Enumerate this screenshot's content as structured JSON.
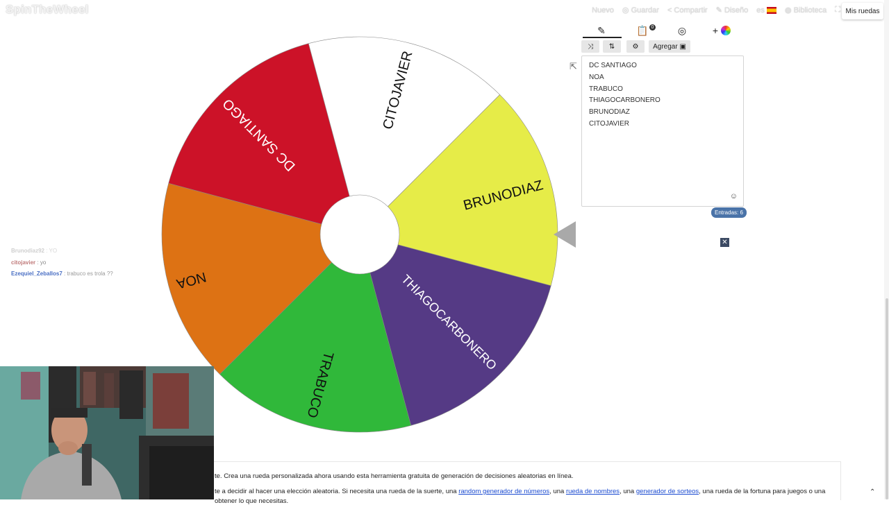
{
  "header": {
    "logo": "SpinTheWheel",
    "nav": [
      "Nuevo",
      "Guardar",
      "Compartir",
      "Diseño",
      "es",
      "Biblioteca"
    ],
    "my_wheels": "Mis ruedas"
  },
  "wheel": {
    "segments": [
      {
        "label": "DC SANTIAGO",
        "color": "#cc1228"
      },
      {
        "label": "NOA",
        "color": "#dd7214"
      },
      {
        "label": "TRABUCO",
        "color": "#30b83a"
      },
      {
        "label": "THIAGOCARBONERO",
        "color": "#553a85"
      },
      {
        "label": "BRUNODIAZ",
        "color": "#e6ec48"
      },
      {
        "label": "CITOJAVIER",
        "color": "#ffffff"
      }
    ]
  },
  "editor": {
    "tabs": [
      "pencil-icon",
      "clipboard-icon",
      "eye-hidden-icon",
      "plus-color-icon"
    ],
    "badge": "0",
    "add_label": "Agregar",
    "entries": [
      "DC SANTIAGO",
      "NOA",
      "TRABUCO",
      "THIAGOCARBONERO",
      "BRUNODIAZ",
      "CITOJAVIER"
    ],
    "count_label": "Entradas: 6"
  },
  "chat": [
    {
      "user": "Brunodiaz92",
      "msg": ": YO",
      "color": "#cfcfcf"
    },
    {
      "user": "citojavier",
      "msg": ": yo",
      "color": "#c07a7a"
    },
    {
      "user": "Ezequiel_Zeballos7",
      "msg": ": trabuco es trola ??",
      "color": "#4a6fc4"
    }
  ],
  "footer": {
    "line1": "te. Crea una rueda personalizada ahora usando esta herramienta gratuita de generación de decisiones aleatorias en línea.",
    "line2_a": "te a decidir al hacer una elección aleatoria. Si necesita una rueda de la suerte, una ",
    "link1": "random generador de números",
    "line2_b": ", una ",
    "link2": "rueda de nombres",
    "line2_c": ", una ",
    "link3": "generador de sorteos",
    "line2_d": ", una rueda de la fortuna para juegos o una",
    "line3": "obtener lo que necesitas."
  }
}
